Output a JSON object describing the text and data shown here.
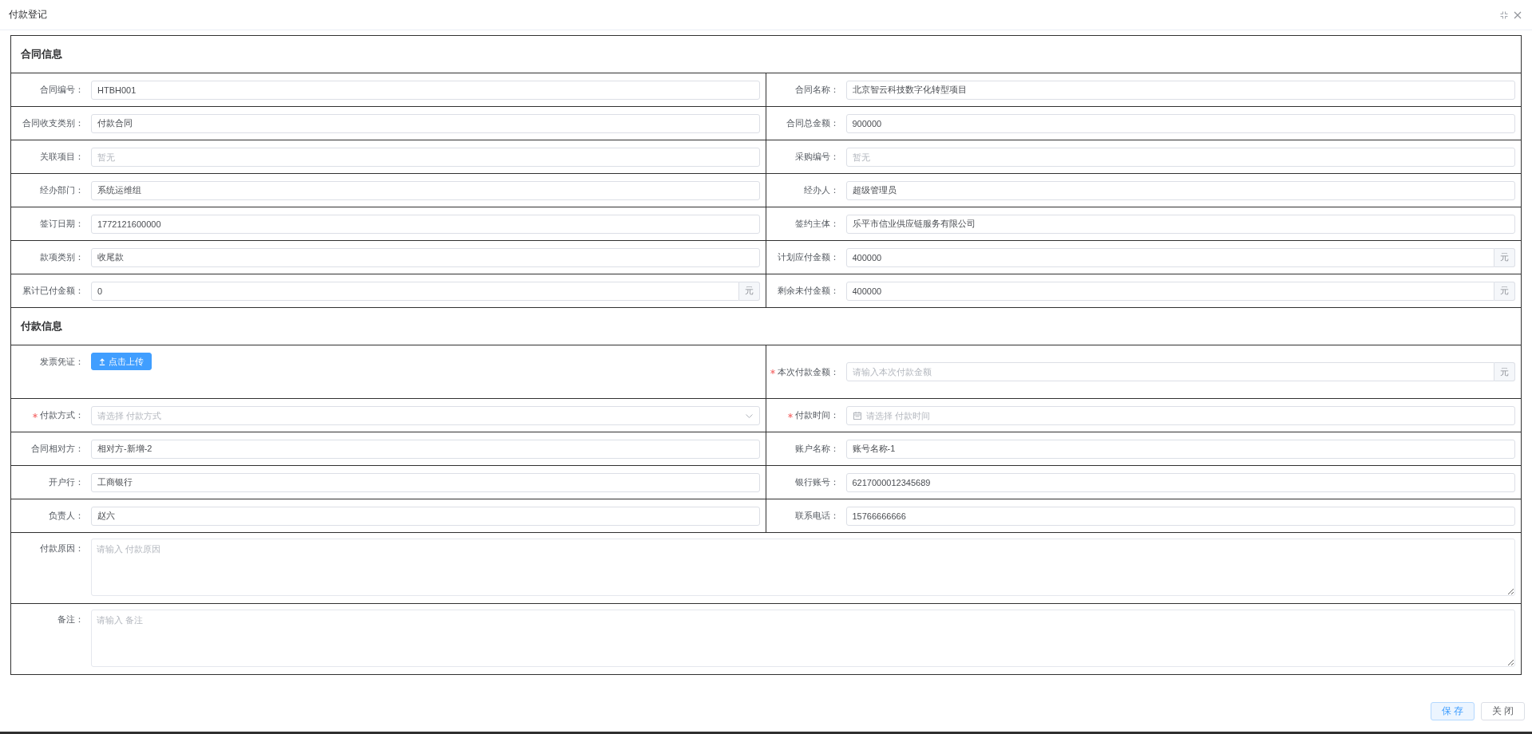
{
  "dialog": {
    "title": "付款登记"
  },
  "sections": [
    {
      "title": "合同信息",
      "fields": [
        {
          "label": "合同编号：",
          "kind": "input",
          "required": false,
          "value": "HTBH001"
        },
        {
          "label": "合同名称：",
          "kind": "input",
          "required": false,
          "value": "北京智云科技数字化转型项目"
        },
        {
          "label": "合同收支类别：",
          "kind": "input",
          "required": false,
          "value": "付款合同"
        },
        {
          "label": "合同总金额：",
          "kind": "input",
          "required": false,
          "value": "900000"
        },
        {
          "label": "关联项目：",
          "kind": "input",
          "required": false,
          "placeholder": "暂无"
        },
        {
          "label": "采购编号：",
          "kind": "input",
          "required": false,
          "placeholder": "暂无"
        },
        {
          "label": "经办部门：",
          "kind": "input",
          "required": false,
          "value": "系统运维组"
        },
        {
          "label": "经办人：",
          "kind": "input",
          "required": false,
          "value": "超级管理员"
        },
        {
          "label": "签订日期：",
          "kind": "input",
          "required": false,
          "value": "1772121600000"
        },
        {
          "label": "签约主体：",
          "kind": "input",
          "required": false,
          "value": "乐平市信业供应链服务有限公司"
        },
        {
          "label": "款项类别：",
          "kind": "input",
          "required": false,
          "value": "收尾款"
        },
        {
          "label": "计划应付金额：",
          "kind": "input",
          "required": false,
          "value": "400000",
          "suffix": "元"
        },
        {
          "label": "累计已付金额：",
          "kind": "input",
          "required": false,
          "value": "0",
          "suffix": "元"
        },
        {
          "label": "剩余未付金额：",
          "kind": "input",
          "required": false,
          "value": "400000",
          "suffix": "元"
        }
      ]
    },
    {
      "title": "付款信息",
      "fields": [
        {
          "label": "发票凭证：",
          "kind": "upload",
          "required": false,
          "button": "点击上传"
        },
        {
          "label": "本次付款金额：",
          "kind": "input",
          "required": true,
          "placeholder": "请输入本次付款金额",
          "suffix": "元"
        },
        {
          "label": "付款方式：",
          "kind": "select",
          "required": true,
          "placeholder": "请选择 付款方式"
        },
        {
          "label": "付款时间：",
          "kind": "date",
          "required": true,
          "placeholder": "请选择 付款时间"
        },
        {
          "label": "合同相对方：",
          "kind": "input",
          "required": false,
          "value": "相对方-新增-2"
        },
        {
          "label": "账户名称：",
          "kind": "input",
          "required": false,
          "value": "账号名称-1"
        },
        {
          "label": "开户行：",
          "kind": "input",
          "required": false,
          "value": "工商银行"
        },
        {
          "label": "银行账号：",
          "kind": "input",
          "required": false,
          "value": "6217000012345689"
        },
        {
          "label": "负责人：",
          "kind": "input",
          "required": false,
          "value": "赵六"
        },
        {
          "label": "联系电话：",
          "kind": "input",
          "required": false,
          "value": "15766666666"
        },
        {
          "label": "付款原因：",
          "kind": "textarea",
          "required": false,
          "placeholder": "请输入 付款原因"
        },
        {
          "label": "备注：",
          "kind": "textarea",
          "required": false,
          "placeholder": "请输入 备注"
        }
      ]
    }
  ],
  "buttons": [
    {
      "label": "保存",
      "kind": "primary"
    },
    {
      "label": "关闭",
      "kind": "default"
    }
  ]
}
